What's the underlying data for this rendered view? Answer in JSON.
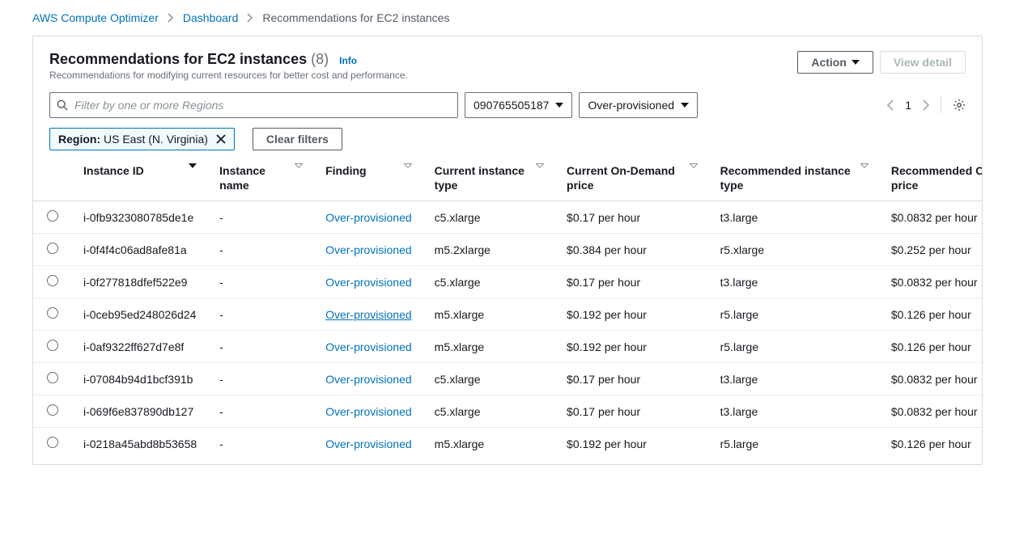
{
  "breadcrumbs": {
    "root": "AWS Compute Optimizer",
    "dashboard": "Dashboard",
    "current": "Recommendations for EC2 instances"
  },
  "header": {
    "title": "Recommendations for EC2 instances",
    "count": "(8)",
    "info": "Info",
    "subtitle": "Recommendations for modifying current resources for better cost and performance."
  },
  "buttons": {
    "action": "Action",
    "view_detail": "View detail",
    "clear_filters": "Clear filters"
  },
  "filters": {
    "search_placeholder": "Filter by one or more Regions",
    "account": "090765505187",
    "finding_filter": "Over-provisioned",
    "chip_label": "Region:",
    "chip_value": " US East (N. Virginia)"
  },
  "pager": {
    "page": "1"
  },
  "columns": {
    "instance_id": "Instance ID",
    "instance_name": "Instance name",
    "finding": "Finding",
    "current_type": "Current instance type",
    "current_price": "Current On-Demand price",
    "rec_type": "Recommended instance type",
    "rec_price": "Recommended On-Demand price"
  },
  "rows": [
    {
      "id": "i-0fb9323080785de1e",
      "name": "-",
      "finding": "Over-provisioned",
      "ctype": "c5.xlarge",
      "cprice": "$0.17 per hour",
      "rtype": "t3.large",
      "rprice": "$0.0832 per hour"
    },
    {
      "id": "i-0f4f4c06ad8afe81a",
      "name": "-",
      "finding": "Over-provisioned",
      "ctype": "m5.2xlarge",
      "cprice": "$0.384 per hour",
      "rtype": "r5.xlarge",
      "rprice": "$0.252 per hour"
    },
    {
      "id": "i-0f277818dfef522e9",
      "name": "-",
      "finding": "Over-provisioned",
      "ctype": "c5.xlarge",
      "cprice": "$0.17 per hour",
      "rtype": "t3.large",
      "rprice": "$0.0832 per hour"
    },
    {
      "id": "i-0ceb95ed248026d24",
      "name": "-",
      "finding": "Over-provisioned",
      "ctype": "m5.xlarge",
      "cprice": "$0.192 per hour",
      "rtype": "r5.large",
      "rprice": "$0.126 per hour",
      "underline": true
    },
    {
      "id": "i-0af9322ff627d7e8f",
      "name": "-",
      "finding": "Over-provisioned",
      "ctype": "m5.xlarge",
      "cprice": "$0.192 per hour",
      "rtype": "r5.large",
      "rprice": "$0.126 per hour"
    },
    {
      "id": "i-07084b94d1bcf391b",
      "name": "-",
      "finding": "Over-provisioned",
      "ctype": "c5.xlarge",
      "cprice": "$0.17 per hour",
      "rtype": "t3.large",
      "rprice": "$0.0832 per hour"
    },
    {
      "id": "i-069f6e837890db127",
      "name": "-",
      "finding": "Over-provisioned",
      "ctype": "c5.xlarge",
      "cprice": "$0.17 per hour",
      "rtype": "t3.large",
      "rprice": "$0.0832 per hour"
    },
    {
      "id": "i-0218a45abd8b53658",
      "name": "-",
      "finding": "Over-provisioned",
      "ctype": "m5.xlarge",
      "cprice": "$0.192 per hour",
      "rtype": "r5.large",
      "rprice": "$0.126 per hour"
    }
  ]
}
